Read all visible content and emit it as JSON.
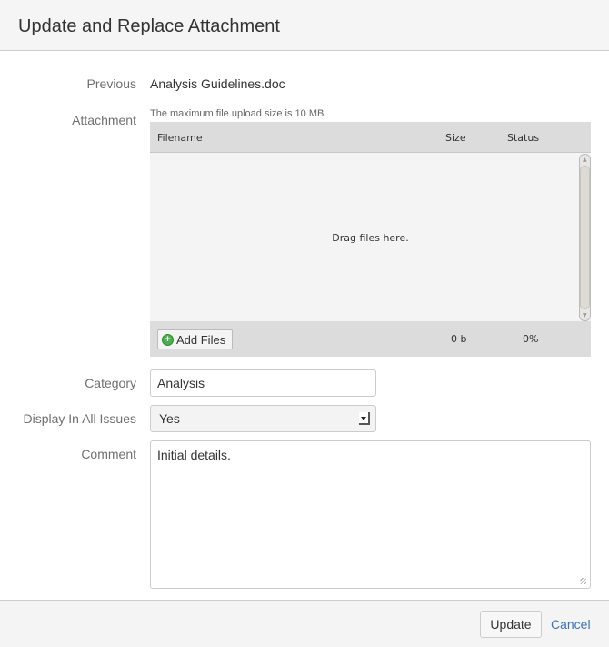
{
  "dialog": {
    "title": "Update and Replace Attachment"
  },
  "form": {
    "previous_label": "Previous",
    "previous_value": "Analysis Guidelines.doc",
    "attachment_label": "Attachment",
    "max_size_note": "The maximum file upload size is 10 MB.",
    "uploader": {
      "col_filename": "Filename",
      "col_size": "Size",
      "col_status": "Status",
      "drop_text": "Drag files here.",
      "add_files": "Add Files",
      "total_size": "0 b",
      "total_status": "0%"
    },
    "category_label": "Category",
    "category_value": "Analysis",
    "display_label": "Display In All Issues",
    "display_value": "Yes",
    "comment_label": "Comment",
    "comment_value": "Initial details."
  },
  "footer": {
    "update": "Update",
    "cancel": "Cancel"
  }
}
